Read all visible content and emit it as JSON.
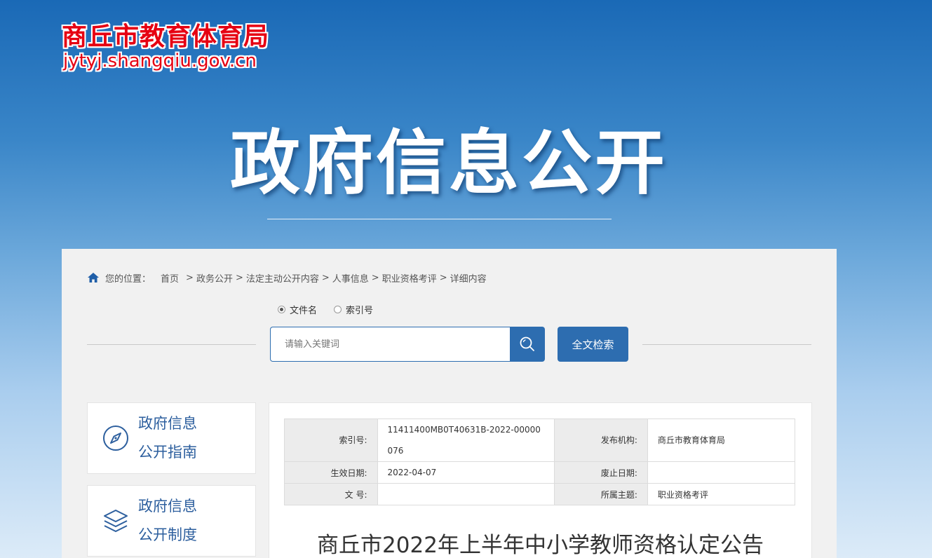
{
  "logo": {
    "title": "商丘市教育体育局",
    "url": "jytyj.shangqiu.gov.cn"
  },
  "hero": {
    "title": "政府信息公开"
  },
  "breadcrumb": {
    "prefix": "您的位置：",
    "items": [
      "首页",
      "政务公开",
      "法定主动公开内容",
      "人事信息",
      "职业资格考评",
      "详细内容"
    ],
    "separator": ">"
  },
  "search": {
    "options": [
      {
        "label": "文件名",
        "selected": true
      },
      {
        "label": "索引号",
        "selected": false
      }
    ],
    "placeholder": "请输入关键词",
    "fulltext_label": "全文检索",
    "icon": "search-icon"
  },
  "sidebar": {
    "items": [
      {
        "line1": "政府信息",
        "line2": "公开指南",
        "icon": "compass-icon"
      },
      {
        "line1": "政府信息",
        "line2": "公开制度",
        "icon": "layers-icon"
      }
    ]
  },
  "info_table": {
    "index_label": "索引号:",
    "index_value": "11411400MB0T40631B-2022-00000076",
    "org_label": "发布机构:",
    "org_value": "商丘市教育体育局",
    "effective_label": "生效日期:",
    "effective_value": "2022-04-07",
    "expire_label": "废止日期:",
    "expire_value": "",
    "docno_label": "文 号:",
    "docno_value": "",
    "topic_label": "所属主题:",
    "topic_value": "职业资格考评"
  },
  "article": {
    "title": "商丘市2022年上半年中小学教师资格认定公告"
  },
  "colors": {
    "accent": "#2d6db0",
    "logo_red": "#e60012",
    "sidebar_text": "#2d5f9e"
  }
}
